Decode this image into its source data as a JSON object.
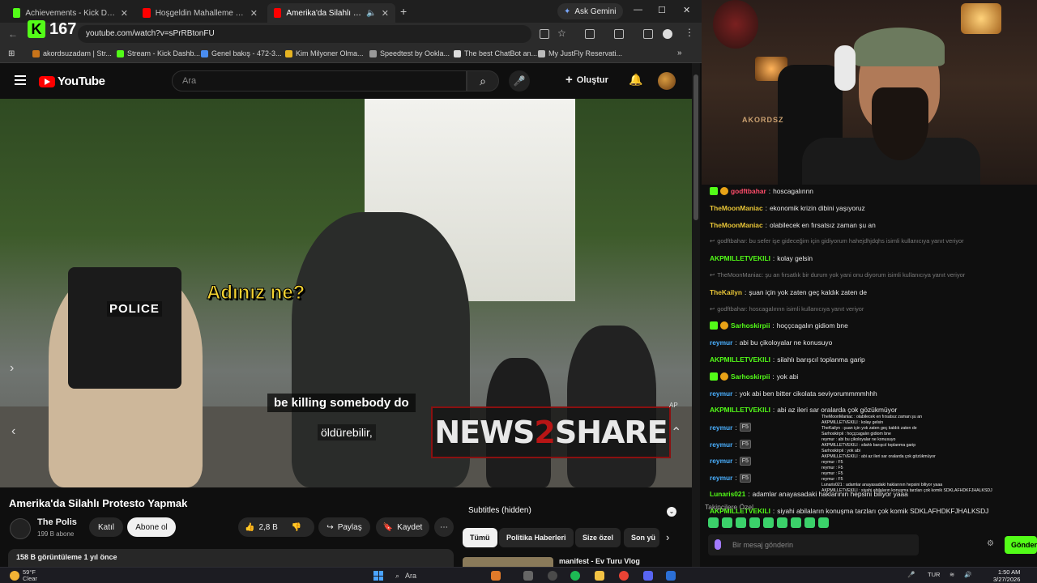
{
  "browser": {
    "tabs": [
      {
        "title": "Achievements - Kick Dashboard",
        "color": "#53fc18"
      },
      {
        "title": "Hoşgeldin Mahalleme Cypher -",
        "color": "#ff0000"
      },
      {
        "title": "Amerika'da Silahlı Protesto",
        "color": "#ff0000"
      }
    ],
    "ask_gemini": "Ask Gemini",
    "url": "youtube.com/watch?v=sPrRBtonFU",
    "kick_overlay": {
      "logo": "K",
      "count": "167"
    },
    "bookmarks": [
      "akordsuzadam | Str...",
      "Stream - Kick Dashb...",
      "Genel bakış - 472-3...",
      "Kim Milyoner Olma...",
      "Speedtest by Ookla...",
      "The best ChatBot an...",
      "My JustFly Reservati..."
    ]
  },
  "youtube": {
    "brand": "YouTube",
    "search_placeholder": "Ara",
    "create_label": "Oluştur",
    "video": {
      "overlay_question": "Adınız ne?",
      "subtitle_en": "be killing somebody do",
      "subtitle_tr": "öldürebilir,",
      "police_label": "POLICE",
      "watermark_left": "NEWS",
      "watermark_mid": "2",
      "watermark_right": "SHARE",
      "ap_label": "AP"
    },
    "title": "Amerika'da Silahlı Protesto Yapmak",
    "channel": {
      "name": "The Polis",
      "subs": "199 B abone"
    },
    "join_label": "Katıl",
    "subscribe_label": "Abone ol",
    "likes": "2,8 B",
    "share_label": "Paylaş",
    "save_label": "Kaydet",
    "views_date": "158 B görüntüleme  1 yıl önce",
    "subtitles_label": "Subtitles (hidden)",
    "chips": [
      "Tümü",
      "Politika Haberleri",
      "Size özel",
      "Son yü"
    ],
    "rec_title": "manifest - Ev Turu Vlog"
  },
  "stream": {
    "overlay_brand": "AKORDSZ",
    "messages": [
      {
        "user": "godftbahar",
        "text": "hoscagalınnn",
        "color": "#ff4d6a",
        "badges": true
      },
      {
        "user": "TheMoonManiac",
        "text": "ekonomik krizin dibini yaşıyoruz",
        "color": "#e8c537"
      },
      {
        "user": "TheMoonManiac",
        "text": "olabilecek en fırsatsız zaman şu an",
        "color": "#e8c537"
      },
      {
        "reply": "godftbahar: bu sefer işe gideceğim için gidiyorum hahejdhjdqhs isimli kullanıcıya yanıt veriyor"
      },
      {
        "user": "AKPMILLETVEKILI",
        "text": "kolay gelsin",
        "color": "#53fc18"
      },
      {
        "reply": "TheMoonManiac: şu an fırsatlık bir durum yok yani onu diyorum isimli kullanıcıya yanıt veriyor"
      },
      {
        "user": "TheKailyn",
        "text": "şuan için yok zaten geç kaldık zaten de",
        "color": "#e8c537"
      },
      {
        "reply": "godftbahar: hoscagalınnn isimli kullanıcıya yanıt veriyor"
      },
      {
        "user": "Sarhoskirpii",
        "text": "hoççcagalın gidiom bne",
        "color": "#53fc18",
        "badges": true
      },
      {
        "user": "reymur",
        "text": "abi bu çikoloyalar ne konusuyo",
        "color": "#4ab0ff"
      },
      {
        "user": "AKPMILLETVEKILI",
        "text": "silahlı barışcıl toplanma garip",
        "color": "#53fc18"
      },
      {
        "user": "Sarhoskirpii",
        "text": "yok abi",
        "color": "#53fc18",
        "badges": true
      },
      {
        "user": "reymur",
        "text": "yok abi ben bitter cikolata seviyorummmmhhh",
        "color": "#4ab0ff"
      },
      {
        "user": "AKPMILLETVEKILI",
        "text": "abi az ileri sar oralarda çok gözükmüyor",
        "color": "#53fc18"
      },
      {
        "user": "reymur",
        "text": "F5",
        "color": "#4ab0ff",
        "f5": true
      },
      {
        "user": "reymur",
        "text": "F5",
        "color": "#4ab0ff",
        "f5": true
      },
      {
        "user": "reymur",
        "text": "F5",
        "color": "#4ab0ff",
        "f5": true
      },
      {
        "user": "reymur",
        "text": "F5",
        "color": "#4ab0ff",
        "f5": true
      },
      {
        "user": "Lunaris021",
        "text": "adamlar anayasadaki haklarının hepsini biliyor yaaa",
        "color": "#53fc18"
      },
      {
        "user": "AKPMILLETVEKILI",
        "text": "siyahi abilaların konuşma tarzları çok komik SDKLAFHDKFJHALKSDJ",
        "color": "#53fc18"
      }
    ],
    "mini_chat": [
      "TheMoonManiac : olabilecek en fırsatsız zaman şu an",
      "AKPMILLETVEKILI : kolay gelsin",
      "TheKailyn : şuan için yok zaten geç kaldık zaten de",
      "Sarhoskirpii : hoççcagalın gidiom bne",
      "reymur : abi bu çikoloyalar ne konusuyo",
      "AKPMILLETVEKILI : silahlı barışcıl toplanma garip",
      "Sarhoskirpii : yok abi",
      "AKPMILLETVEKILI : abi az ileri sar oralarda çok gözükmüyor",
      "reymur : F5",
      "reymur : F5",
      "reymur : F5",
      "reymur : F5",
      "Lunaris021 : adamlar anayasadaki haklarının hepsini biliyor yaaa",
      "AKPMILLETVEKILI : siyahi abilaların konuşma tarzları çok komik SDKLAFHDKFJHALKSDJ"
    ],
    "followers_label": "Takipçilere Özel",
    "chat_placeholder": "Bir mesaj gönderin",
    "send_label": "Gönder"
  },
  "taskbar": {
    "temp": "59°F",
    "weather": "Clear",
    "search_label": "Ara",
    "lang": "TUR",
    "time": "1:50 AM",
    "date": "3/27/2026"
  }
}
